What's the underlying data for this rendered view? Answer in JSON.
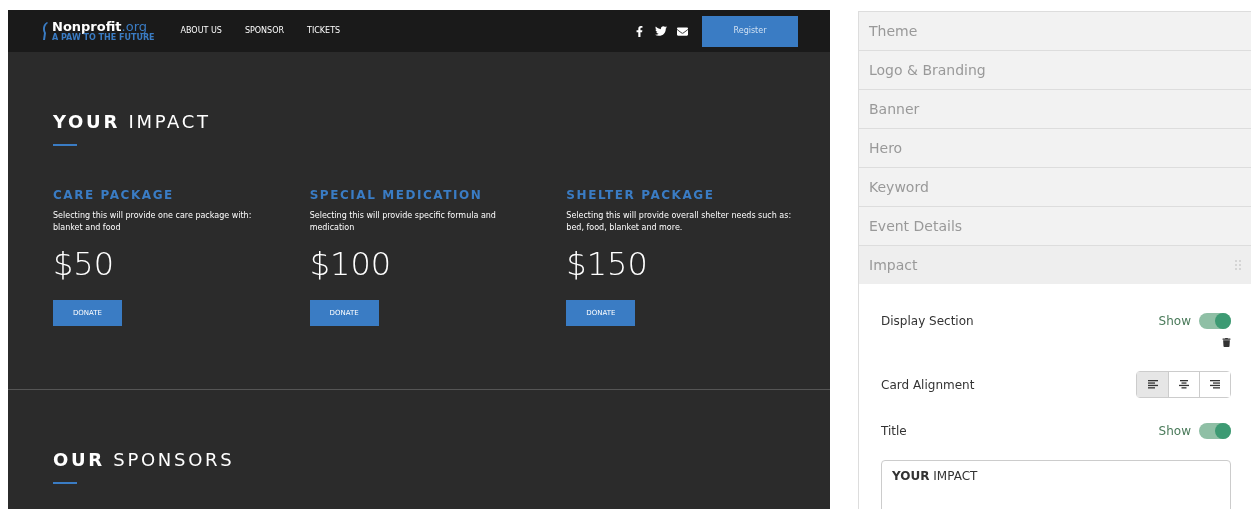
{
  "nav": {
    "logo_name": "Nonprofit",
    "logo_suffix": ".org",
    "tagline": "A PAW TO THE FUTURE",
    "links": [
      "ABOUT US",
      "SPONSOR",
      "TICKETS"
    ],
    "register": "Register"
  },
  "impact": {
    "title": "**YOUR** IMPACT",
    "cards": [
      {
        "title": "CARE PACKAGE",
        "text": "Selecting this will provide one care package with: blanket and food",
        "price": "$50",
        "button": "DONATE"
      },
      {
        "title": "SPECIAL MEDICATION",
        "text": "Selecting this will provide specific formula and medication",
        "price": "$100",
        "button": "DONATE"
      },
      {
        "title": "SHELTER PACKAGE",
        "text": "Selecting this will provide overall shelter needs such as: bed, food, blanket and more.",
        "price": "$150",
        "button": "DONATE"
      }
    ]
  },
  "sponsors": {
    "title": "**OUR** SPONSORS"
  },
  "sidebar": {
    "items": [
      {
        "label": "Theme",
        "expanded": false
      },
      {
        "label": "Logo & Branding",
        "expanded": false
      },
      {
        "label": "Banner",
        "expanded": false
      },
      {
        "label": "Hero",
        "expanded": false
      },
      {
        "label": "Keyword",
        "expanded": false
      },
      {
        "label": "Event Details",
        "expanded": false
      },
      {
        "label": "Impact",
        "expanded": true
      }
    ],
    "settings": [
      {
        "kind": "toggle",
        "label": "Display Section",
        "state_label": "Show",
        "on": true
      },
      {
        "kind": "alignment",
        "label": "Card Alignment",
        "options": [
          {
            "selected": true
          },
          {
            "selected": false
          },
          {
            "selected": false
          }
        ]
      },
      {
        "kind": "toggle",
        "label": "Title",
        "state_label": "Show",
        "on": true
      },
      {
        "kind": "textarea",
        "value": "**YOUR** IMPACT"
      }
    ]
  }
}
